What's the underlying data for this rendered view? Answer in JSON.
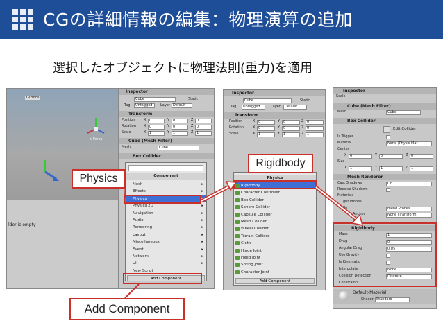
{
  "title": "CGの詳細情報の編集：物理演算の追加",
  "subtitle": "選択したオブジェクトに物理法則(重力)を適用",
  "callouts": {
    "physics": "Physics",
    "rigidbody": "Rigidbody",
    "add_component": "Add Component"
  },
  "panel1": {
    "tab": "Inspector",
    "scene_label": "Gizmos",
    "persp": "< Persp",
    "console_text": "lder is empty",
    "object_name": "Cube",
    "static_label": "Static",
    "tag_label": "Tag",
    "tag_value": "Untagged",
    "layer_label": "Layer",
    "layer_value": "Default",
    "transform_title": "Transform",
    "position_label": "Position",
    "rotation_label": "Rotation",
    "scale_label": "Scale",
    "x_label": "X",
    "y_label": "Y",
    "z_label": "Z",
    "pos": [
      "0",
      "0",
      "0"
    ],
    "rot": [
      "0",
      "0",
      "0"
    ],
    "scl": [
      "1",
      "1",
      "1"
    ],
    "mesh_filter_title": "Cube (Mesh Filter)",
    "mesh_label": "Mesh",
    "mesh_value": "Cube",
    "box_collider_title": "Box Collider",
    "component_menu_title": "Component",
    "component_items": [
      "Mesh",
      "Effects",
      "Physics",
      "Physics 2D",
      "Navigation",
      "Audio",
      "Rendering",
      "Layout",
      "Miscellaneous",
      "Event",
      "Network",
      "UI",
      "New Script"
    ],
    "add_component_btn": "Add Component"
  },
  "panel2": {
    "tab": "Inspector",
    "object_name": "Cube",
    "static_label": "Static",
    "tag_label": "Tag",
    "tag_value": "Untagged",
    "layer_label": "Layer",
    "layer_value": "Default",
    "transform_title": "Transform",
    "position_label": "Position",
    "rotation_label": "Rotation",
    "scale_label": "Scale",
    "x_label": "X",
    "y_label": "Y",
    "z_label": "Z",
    "pos": [
      "0",
      "0",
      "0"
    ],
    "rot": [
      "0",
      "0",
      "0"
    ],
    "scl": [
      "1",
      "1",
      "1"
    ],
    "physics_title": "Physics",
    "physics_items": [
      "Rigidbody",
      "Character Controller",
      "Box Collider",
      "Sphere Collider",
      "Capsule Collider",
      "Mesh Collider",
      "Wheel Collider",
      "Terrain Collider",
      "Cloth",
      "Hinge Joint",
      "Fixed Joint",
      "Spring Joint",
      "Character Joint"
    ],
    "add_component_btn": "Add Component"
  },
  "panel3": {
    "tab": "Inspector",
    "scale_row": "Scale",
    "mesh_filter_title": "Cube (Mesh Filter)",
    "mesh_label": "Mesh",
    "mesh_value": "Cube",
    "box_collider_title": "Box Collider",
    "edit_collider": "Edit Collider",
    "is_trigger": "Is Trigger",
    "material_label": "Material",
    "material_value": "None (Physic Mat",
    "center_label": "Center",
    "size_label": "Size",
    "x_label": "X",
    "y_label": "Y",
    "z_label": "Z",
    "center": [
      "0",
      "0",
      "0"
    ],
    "size": [
      "1",
      "1",
      "1"
    ],
    "mesh_renderer_title": "Mesh Renderer",
    "cast_shadows": "Cast Shadows",
    "cast_shadows_value": "On",
    "receive_shadows": "Receive Shadows",
    "materials": "Materials",
    "light_probes": "ght Probes",
    "reflection_probes": "Re",
    "reflection_value": "Blend Probes",
    "anchor_override": "Anchor",
    "anchor_value": "None (Transform",
    "rigidbody_title": "Rigidbody",
    "rb_rows": [
      {
        "label": "Mass",
        "value": "1"
      },
      {
        "label": "Drag",
        "value": "0"
      },
      {
        "label": "Angular Drag",
        "value": "0.05"
      },
      {
        "label": "Use Gravity",
        "value": ""
      },
      {
        "label": "Is Kinematic",
        "value": ""
      },
      {
        "label": "Interpolate",
        "value": "None"
      },
      {
        "label": "Collision Detection",
        "value": "Discrete"
      }
    ],
    "constraints": "Constraints",
    "default_material": "Default-Material",
    "shader_label": "Shader",
    "shader_value": "Standard"
  },
  "colors": {
    "title_bar": "#1f4e99",
    "callout_border": "#c9302c",
    "selection": "#3d6fd6"
  }
}
